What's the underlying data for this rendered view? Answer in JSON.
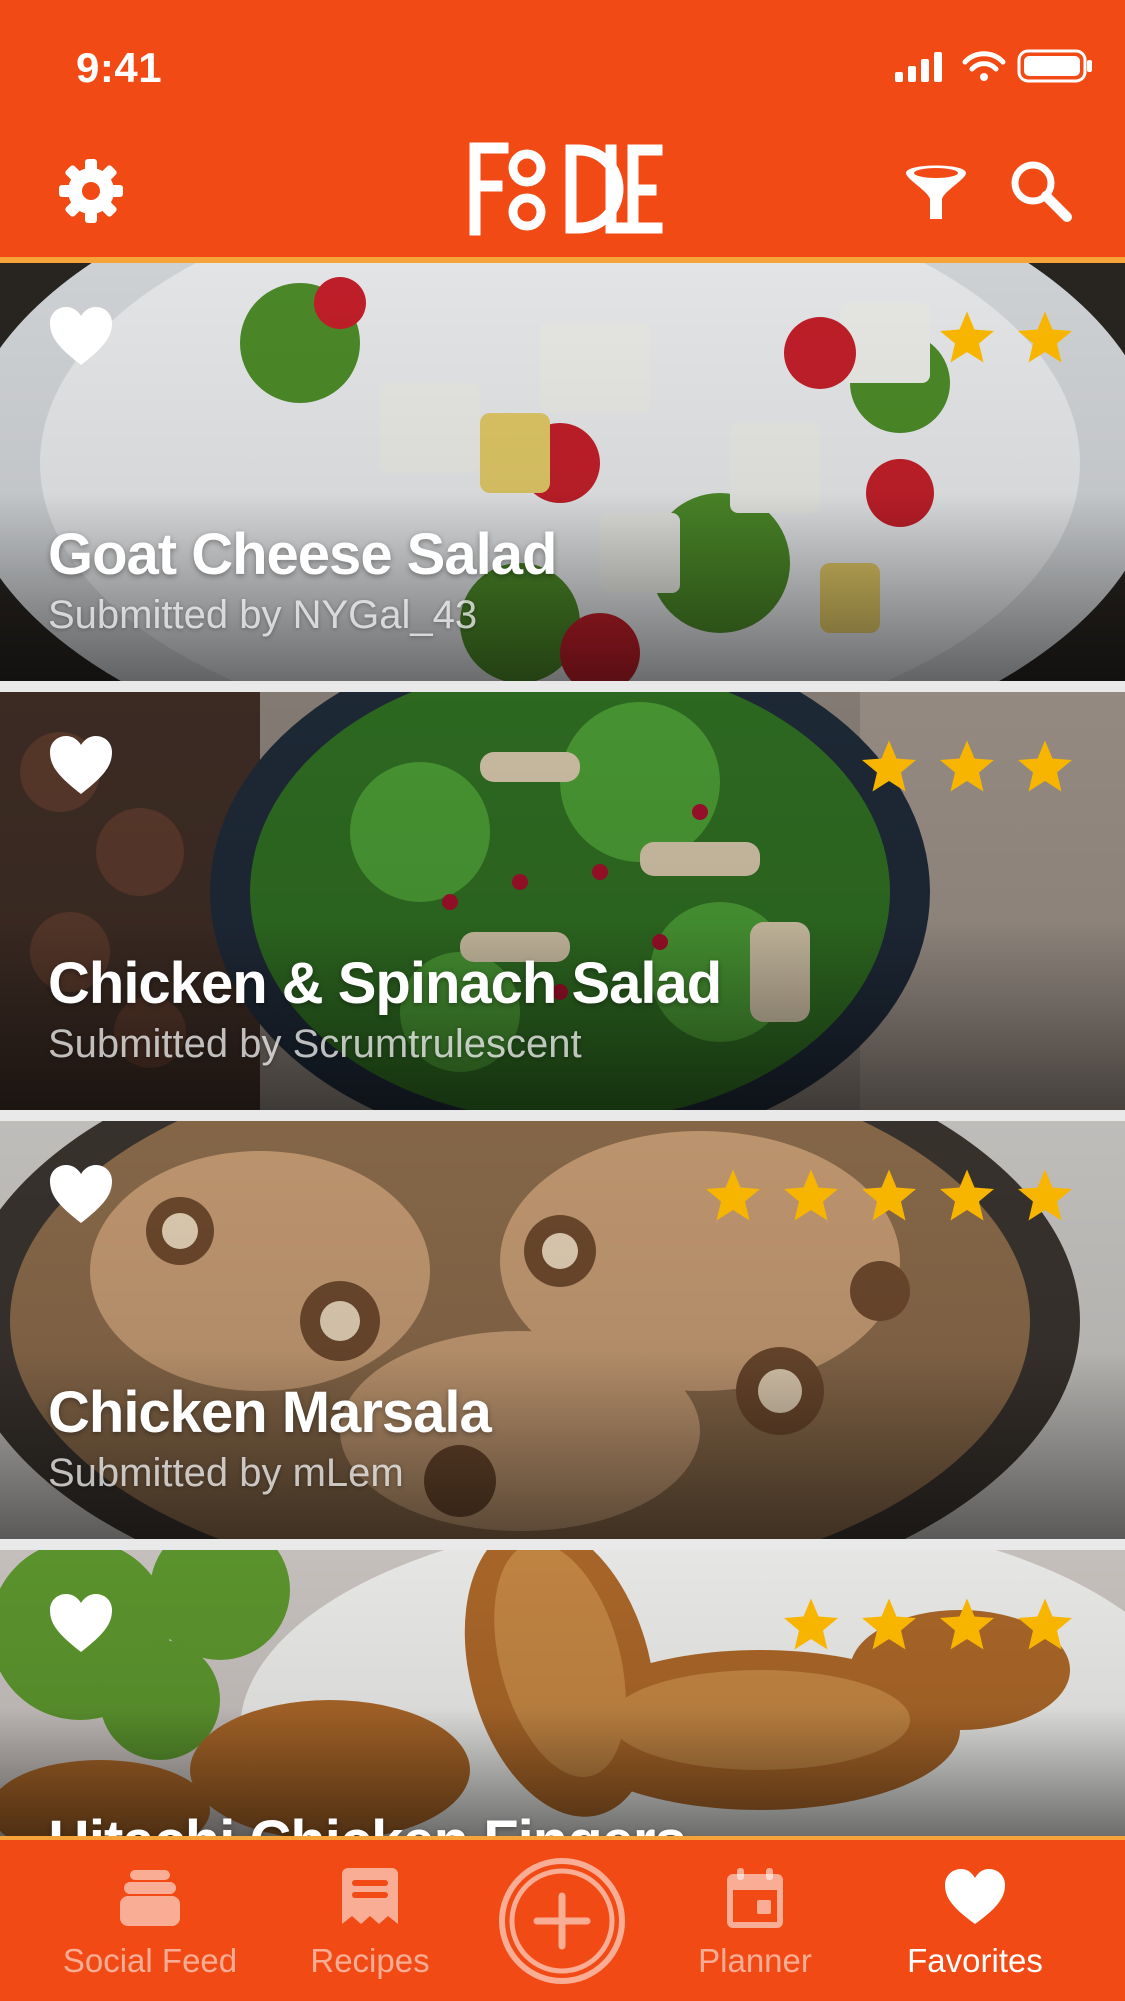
{
  "status_bar": {
    "time": "9:41"
  },
  "header": {
    "logo_text": "FooDLE",
    "settings_icon": "gear-icon",
    "filter_icon": "filter-icon",
    "search_icon": "search-icon"
  },
  "cards": [
    {
      "title": "Goat Cheese Salad",
      "submitted": "Submitted by NYGal_43",
      "rating": 2,
      "favorite": true
    },
    {
      "title": "Chicken & Spinach Salad",
      "submitted": "Submitted by Scrumtrulescent",
      "rating": 3,
      "favorite": true
    },
    {
      "title": "Chicken Marsala",
      "submitted": "Submitted by mLem",
      "rating": 5,
      "favorite": true
    },
    {
      "title": "Hitachi Chicken Fingers",
      "submitted": "",
      "rating": 4,
      "favorite": true
    }
  ],
  "tabbar": {
    "social_feed": "Social Feed",
    "recipes": "Recipes",
    "planner": "Planner",
    "favorites": "Favorites",
    "active": "favorites"
  },
  "colors": {
    "brand": "#f24a15",
    "accent": "#f6a33a",
    "star": "#f7b500"
  }
}
